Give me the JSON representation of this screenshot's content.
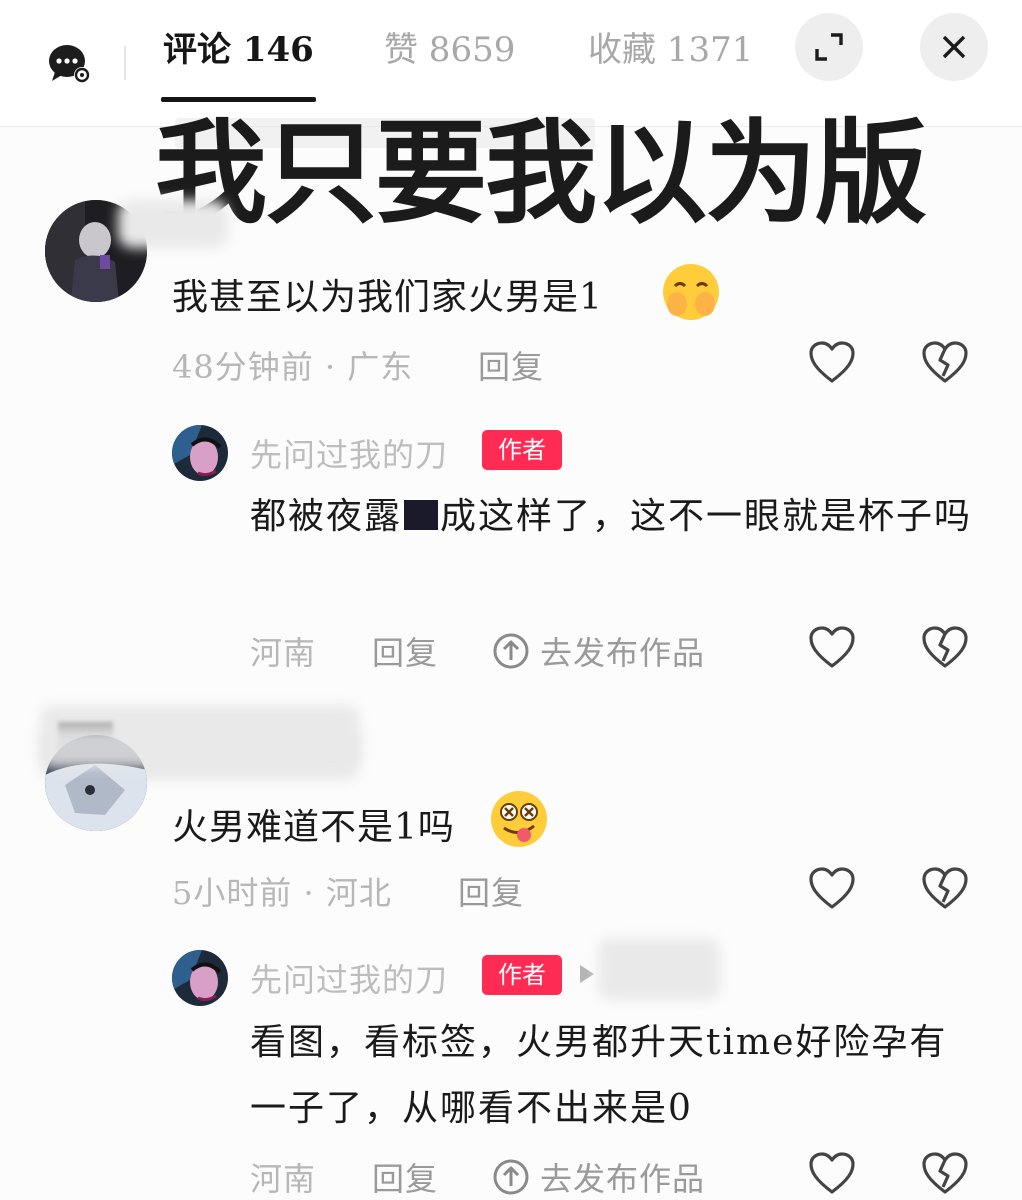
{
  "header": {
    "tabs": [
      {
        "label": "评论 146",
        "active": true
      },
      {
        "label": "赞 8659",
        "active": false
      },
      {
        "label": "收藏 1371",
        "active": false
      }
    ],
    "icons": [
      "chat-settings-icon",
      "expand-icon",
      "close-icon"
    ]
  },
  "overlay_caption": "我只要我以为版",
  "comments": [
    {
      "text": "我甚至以为我们家火男是1",
      "emoji": "giggle-emoji",
      "time": "48分钟前 · 广东",
      "reply_label": "回复",
      "reply": {
        "author": "先问过我的刀",
        "badge": "作者",
        "text_before": "都被夜露",
        "text_after": "成这样了，这不一眼就是杯子吗",
        "location": "河南",
        "reply_label": "回复",
        "publish_label": "去发布作品"
      }
    },
    {
      "text": "火男难道不是1吗",
      "emoji": "dizzy-tongue-emoji",
      "time": "5小时前 · 河北",
      "reply_label": "回复",
      "reply": {
        "author": "先问过我的刀",
        "badge": "作者",
        "text": "看图，看标签，火男都升天time好险孕有一子了，从哪看不出来是0",
        "location": "河南",
        "reply_label": "回复",
        "publish_label": "去发布作品"
      }
    }
  ],
  "colors": {
    "badge": "#fe2c55",
    "muted": "#b7b7b7",
    "tab_inactive": "#a8a8a8"
  }
}
